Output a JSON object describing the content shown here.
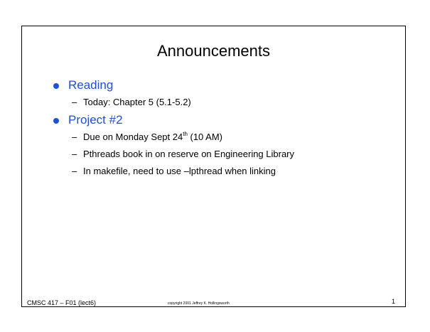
{
  "slide": {
    "title": "Announcements",
    "bullets": [
      {
        "label": "Reading",
        "subs": [
          {
            "dash": "–",
            "text": "Today: Chapter 5 (5.1-5.2)"
          }
        ]
      },
      {
        "label": "Project #2",
        "subs": [
          {
            "dash": "–",
            "pre": "Due on Monday Sept 24",
            "sup": "th",
            "post": " (10 AM)"
          },
          {
            "dash": "–",
            "text": "Pthreads book in on reserve on Engineering Library"
          },
          {
            "dash": "–",
            "text": "In makefile, need to use –lpthread when linking"
          }
        ]
      }
    ],
    "footer_left": "CMSC 417 – F01  (lect6)",
    "footer_center": "copyright 2001  Jeffrey K. Hollingsworth",
    "page_number": "1"
  },
  "colors": {
    "bullet_heading": "#1e4fd8",
    "bullet_dot": "#1f4fe0",
    "text": "#000000",
    "border": "#000000"
  }
}
